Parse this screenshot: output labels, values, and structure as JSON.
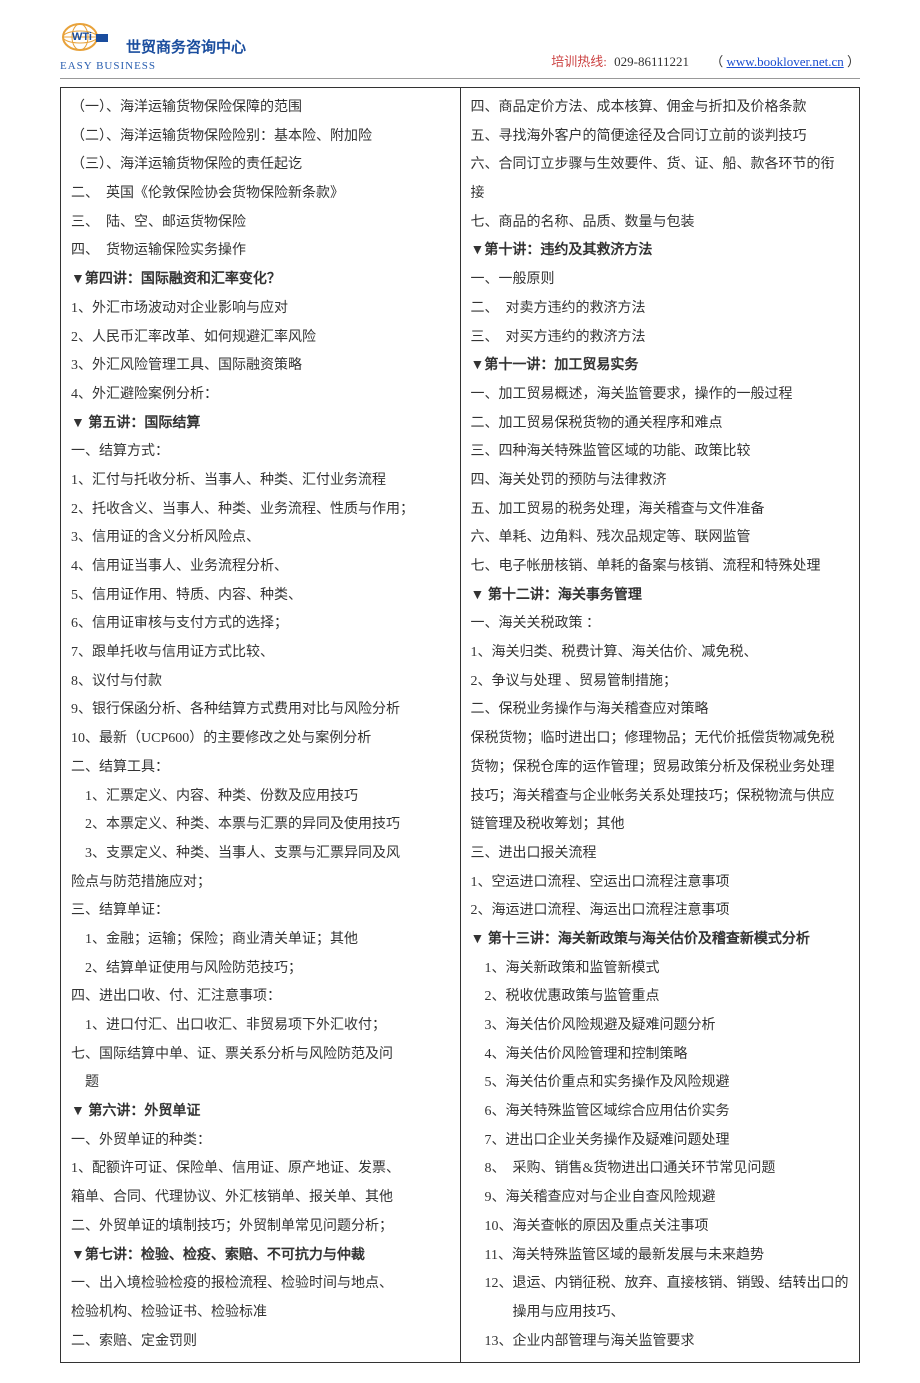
{
  "header": {
    "org_name": "世贸商务咨询中心",
    "tagline": "EASY BUSINESS",
    "hotline_label": "培训热线:",
    "hotline_number": "029-86111221",
    "url": "www.booklover.net.cn",
    "paren_open": "（",
    "paren_close": " ）"
  },
  "left_column": [
    {
      "t": "（一）、海洋运输货物保险保障的范围"
    },
    {
      "t": "（二）、海洋运输货物保险险别：基本险、附加险"
    },
    {
      "t": "（三）、海洋运输货物保险的责任起讫"
    },
    {
      "t": "二、　英国《伦敦保险协会货物保险新条款》"
    },
    {
      "t": "三、　陆、空、邮运货物保险"
    },
    {
      "t": "四、　货物运输保险实务操作"
    },
    {
      "t": "▼第四讲：国际融资和汇率变化？",
      "b": true
    },
    {
      "t": "1、外汇市场波动对企业影响与应对"
    },
    {
      "t": "2、人民币汇率改革、如何规避汇率风险"
    },
    {
      "t": "3、外汇风险管理工具、国际融资策略"
    },
    {
      "t": "4、外汇避险案例分析："
    },
    {
      "t": "▼ 第五讲：国际结算",
      "b": true
    },
    {
      "t": "一、结算方式："
    },
    {
      "t": "1、汇付与托收分析、当事人、种类、汇付业务流程"
    },
    {
      "t": "2、托收含义、当事人、种类、业务流程、性质与作用；"
    },
    {
      "t": "3、信用证的含义分析风险点、"
    },
    {
      "t": "4、信用证当事人、业务流程分析、"
    },
    {
      "t": "5、信用证作用、特质、内容、种类、"
    },
    {
      "t": "6、信用证审核与支付方式的选择；"
    },
    {
      "t": "7、跟单托收与信用证方式比较、"
    },
    {
      "t": "8、议付与付款"
    },
    {
      "t": "9、银行保函分析、各种结算方式费用对比与风险分析"
    },
    {
      "t": "10、最新（UCP600）的主要修改之处与案例分析"
    },
    {
      "t": "二、结算工具："
    },
    {
      "t": "　1、汇票定义、内容、种类、份数及应用技巧"
    },
    {
      "t": "　2、本票定义、种类、本票与汇票的异同及使用技巧"
    },
    {
      "t": "　3、支票定义、种类、当事人、支票与汇票异同及风"
    },
    {
      "t": "险点与防范措施应对；"
    },
    {
      "t": "三、结算单证："
    },
    {
      "t": "　1、金融；运输；保险；商业清关单证；其他"
    },
    {
      "t": "　2、结算单证使用与风险防范技巧；"
    },
    {
      "t": "四、进出口收、付、汇注意事项："
    },
    {
      "t": "　1、进口付汇、出口收汇、非贸易项下外汇收付；"
    },
    {
      "t": "七、国际结算中单、证、票关系分析与风险防范及问"
    },
    {
      "t": "　题"
    },
    {
      "t": "▼ 第六讲：外贸单证",
      "b": true
    },
    {
      "t": "一、外贸单证的种类："
    },
    {
      "t": "1、配额许可证、保险单、信用证、原产地证、发票、"
    },
    {
      "t": "箱单、合同、代理协议、外汇核销单、报关单、其他"
    },
    {
      "t": "二、外贸单证的填制技巧；外贸制单常见问题分析；"
    },
    {
      "t": "▼第七讲：检验、检疫、索赔、不可抗力与仲裁",
      "b": true
    },
    {
      "t": "一、出入境检验检疫的报检流程、检验时间与地点、"
    },
    {
      "t": "检验机构、检验证书、检验标准"
    },
    {
      "t": "二、索赔、定金罚则"
    }
  ],
  "right_column": [
    {
      "t": "四、商品定价方法、成本核算、佣金与折扣及价格条款"
    },
    {
      "t": "五、寻找海外客户的简便途径及合同订立前的谈判技巧"
    },
    {
      "t": "六、合同订立步骤与生效要件、货、证、船、款各环节的衔"
    },
    {
      "t": "接"
    },
    {
      "t": "七、商品的名称、品质、数量与包装"
    },
    {
      "t": "▼第十讲：违约及其救济方法",
      "b": true
    },
    {
      "t": "一、一般原则"
    },
    {
      "t": "二、　对卖方违约的救济方法"
    },
    {
      "t": "三、　对买方违约的救济方法"
    },
    {
      "t": "▼第十一讲：加工贸易实务",
      "b": true
    },
    {
      "t": "一、加工贸易概述，海关监管要求，操作的一般过程"
    },
    {
      "t": "二、加工贸易保税货物的通关程序和难点"
    },
    {
      "t": "三、四种海关特殊监管区域的功能、政策比较"
    },
    {
      "t": "四、海关处罚的预防与法律救济"
    },
    {
      "t": "五、加工贸易的税务处理，海关稽查与文件准备"
    },
    {
      "t": "六、单耗、边角料、残次品规定等、联网监管"
    },
    {
      "t": "七、电子帐册核销、单耗的备案与核销、流程和特殊处理"
    },
    {
      "t": "▼ 第十二讲：海关事务管理",
      "b": true
    },
    {
      "t": "一、海关关税政策 ："
    },
    {
      "t": "1、海关归类、税费计算、海关估价、减免税、"
    },
    {
      "t": "2、争议与处理 、贸易管制措施；"
    },
    {
      "t": "二、保税业务操作与海关稽查应对策略"
    },
    {
      "t": "保税货物；临时进出口；修理物品；无代价抵偿货物减免税"
    },
    {
      "t": "货物；保税仓库的运作管理；贸易政策分析及保税业务处理"
    },
    {
      "t": "技巧；海关稽查与企业帐务关系处理技巧；保税物流与供应"
    },
    {
      "t": "链管理及税收筹划；其他"
    },
    {
      "t": "三、进出口报关流程"
    },
    {
      "t": "1、空运进口流程、空运出口流程注意事项"
    },
    {
      "t": "2、海运进口流程、海运出口流程注意事项"
    },
    {
      "t": "▼ 第十三讲：海关新政策与海关估价及稽查新模式分析",
      "b": true
    },
    {
      "t": "　1、海关新政策和监管新模式"
    },
    {
      "t": "　2、税收优惠政策与监管重点"
    },
    {
      "t": "　3、海关估价风险规避及疑难问题分析"
    },
    {
      "t": "　4、海关估价风险管理和控制策略"
    },
    {
      "t": "　5、海关估价重点和实务操作及风险规避"
    },
    {
      "t": "　6、海关特殊监管区域综合应用估价实务"
    },
    {
      "t": "　7、进出口企业关务操作及疑难问题处理"
    },
    {
      "t": "　8、　采购、销售&货物进出口通关环节常见问题"
    },
    {
      "t": "　9、海关稽查应对与企业自查风险规避"
    },
    {
      "t": "　10、海关查帐的原因及重点关注事项"
    },
    {
      "t": "　11、海关特殊监管区域的最新发展与未来趋势"
    },
    {
      "t": "　12、退运、内销征税、放弃、直接核销、销毁、结转出口的"
    },
    {
      "t": "　　　操用与应用技巧、"
    },
    {
      "t": "　13、企业内部管理与海关监管要求"
    }
  ]
}
